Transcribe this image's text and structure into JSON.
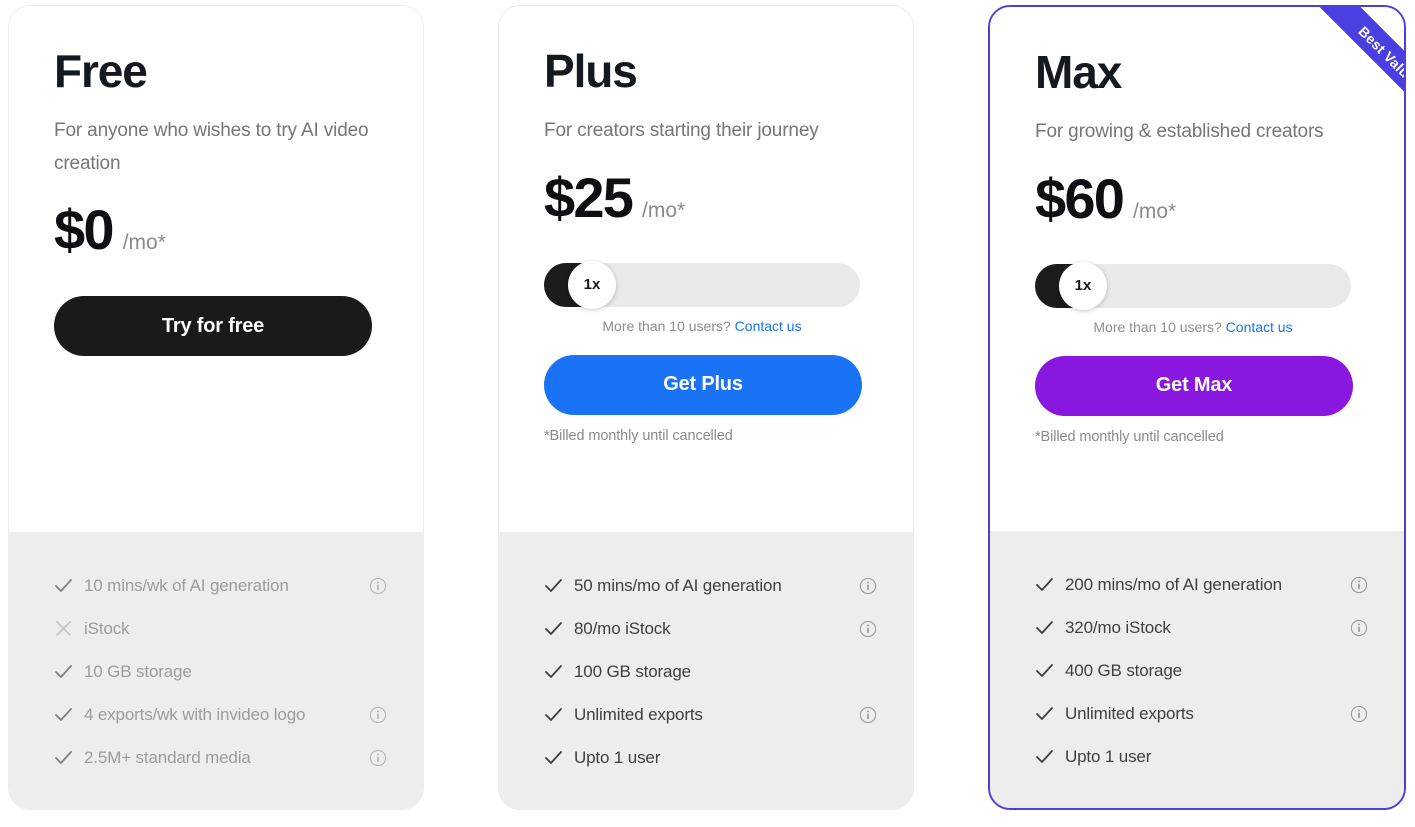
{
  "plans": [
    {
      "id": "free",
      "name": "Free",
      "tagline": "For anyone who wishes to try AI video creation",
      "price": "$0",
      "period": "/mo*",
      "has_slider": false,
      "cta_label": "Try for free",
      "cta_color": "#1a1a1a",
      "billing_note": "",
      "badge": "",
      "features": [
        {
          "label": "10 mins/wk of AI generation",
          "mark": "check",
          "info": true
        },
        {
          "label": "iStock",
          "mark": "cross",
          "info": false
        },
        {
          "label": "10 GB storage",
          "mark": "check",
          "info": false
        },
        {
          "label": "4 exports/wk with invideo logo",
          "mark": "check",
          "info": true
        },
        {
          "label": "2.5M+ standard media",
          "mark": "check",
          "info": true
        }
      ]
    },
    {
      "id": "plus",
      "name": "Plus",
      "tagline": "For creators starting their journey",
      "price": "$25",
      "period": "/mo*",
      "has_slider": true,
      "slider_value": "1x",
      "seat_note_text": "More than 10 users?",
      "seat_note_link": "Contact us",
      "cta_label": "Get Plus",
      "cta_color": "#1a73f5",
      "billing_note": "*Billed monthly until cancelled",
      "badge": "",
      "features": [
        {
          "label": "50 mins/mo of AI generation",
          "mark": "check",
          "info": true
        },
        {
          "label": "80/mo iStock",
          "mark": "check",
          "info": true
        },
        {
          "label": "100 GB storage",
          "mark": "check",
          "info": false
        },
        {
          "label": "Unlimited exports",
          "mark": "check",
          "info": true
        },
        {
          "label": "Upto 1 user",
          "mark": "check",
          "info": false
        }
      ]
    },
    {
      "id": "max",
      "name": "Max",
      "tagline": "For growing & established creators",
      "price": "$60",
      "period": "/mo*",
      "has_slider": true,
      "slider_value": "1x",
      "seat_note_text": "More than 10 users?",
      "seat_note_link": "Contact us",
      "cta_label": "Get Max",
      "cta_color": "#8a17e0",
      "billing_note": "*Billed monthly until cancelled",
      "badge": "Best Value",
      "badge_color": "#4a3fe0",
      "features": [
        {
          "label": "200 mins/mo of AI generation",
          "mark": "check",
          "info": true
        },
        {
          "label": "320/mo iStock",
          "mark": "check",
          "info": true
        },
        {
          "label": "400 GB storage",
          "mark": "check",
          "info": false
        },
        {
          "label": "Unlimited exports",
          "mark": "check",
          "info": true
        },
        {
          "label": "Upto 1 user",
          "mark": "check",
          "info": false
        }
      ]
    }
  ]
}
